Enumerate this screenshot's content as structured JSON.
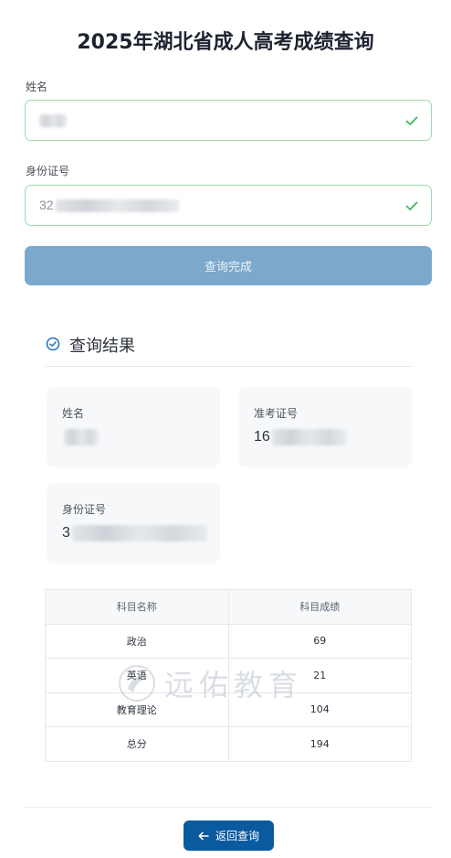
{
  "page": {
    "title": "2025年湖北省成人高考成绩查询"
  },
  "form": {
    "name_label": "姓名",
    "name_value": "",
    "id_label": "身份证号",
    "id_value_prefix": "32",
    "submit_label": "查询完成",
    "valid_icon": "check-icon"
  },
  "result": {
    "title": "查询结果",
    "title_icon": "check-circle-icon",
    "cards": {
      "name_label": "姓名",
      "name_prefix": "",
      "exam_no_label": "准考证号",
      "exam_no_prefix": "16",
      "id_label": "身份证号",
      "id_prefix": "3"
    },
    "table": {
      "headers": [
        "科目名称",
        "科目成绩"
      ],
      "rows": [
        {
          "subject": "政治",
          "score": "69"
        },
        {
          "subject": "英语",
          "score": "21"
        },
        {
          "subject": "教育理论",
          "score": "104"
        },
        {
          "subject": "总分",
          "score": "194"
        }
      ]
    }
  },
  "watermark": {
    "text": "远佑教育"
  },
  "footer": {
    "back_label": "返回查询",
    "back_icon": "arrow-left-icon"
  },
  "colors": {
    "accent": "#0a5aa0",
    "submit_bg": "#7ba8cb",
    "valid_border": "#9fd9b0",
    "valid_icon": "#3fb860"
  }
}
